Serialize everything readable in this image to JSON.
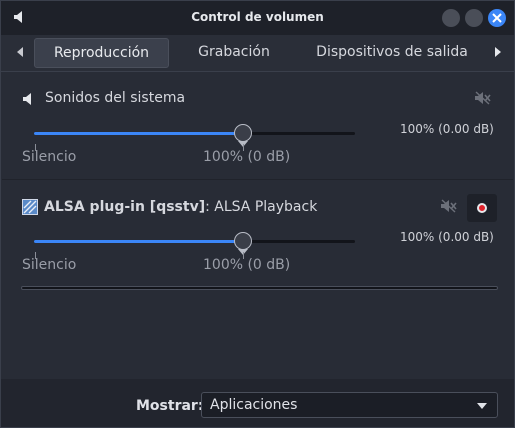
{
  "window": {
    "title": "Control de volumen"
  },
  "tabs": [
    {
      "label": "Reproducción",
      "active": true
    },
    {
      "label": "Grabación",
      "active": false
    },
    {
      "label": "Dispositivos de salida",
      "active": false
    }
  ],
  "system_sounds": {
    "label": "Sonidos del sistema",
    "volume_text": "100% (0.00 dB)",
    "scale_min": "Silencio",
    "scale_mid": "100% (0 dB)",
    "level": 0.65
  },
  "stream": {
    "app_name": "ALSA plug-in [qsstv]",
    "separator": ":",
    "stream_name": "ALSA Playback",
    "volume_text": "100% (0.00 dB)",
    "scale_min": "Silencio",
    "scale_mid": "100% (0 dB)",
    "level": 0.65,
    "peak_level": 0
  },
  "footer": {
    "show_label": "Mostrar:",
    "show_value": "Aplicaciones"
  },
  "colors": {
    "accent": "#3b86f7",
    "background": "#282c36",
    "record": "#e0222b"
  }
}
